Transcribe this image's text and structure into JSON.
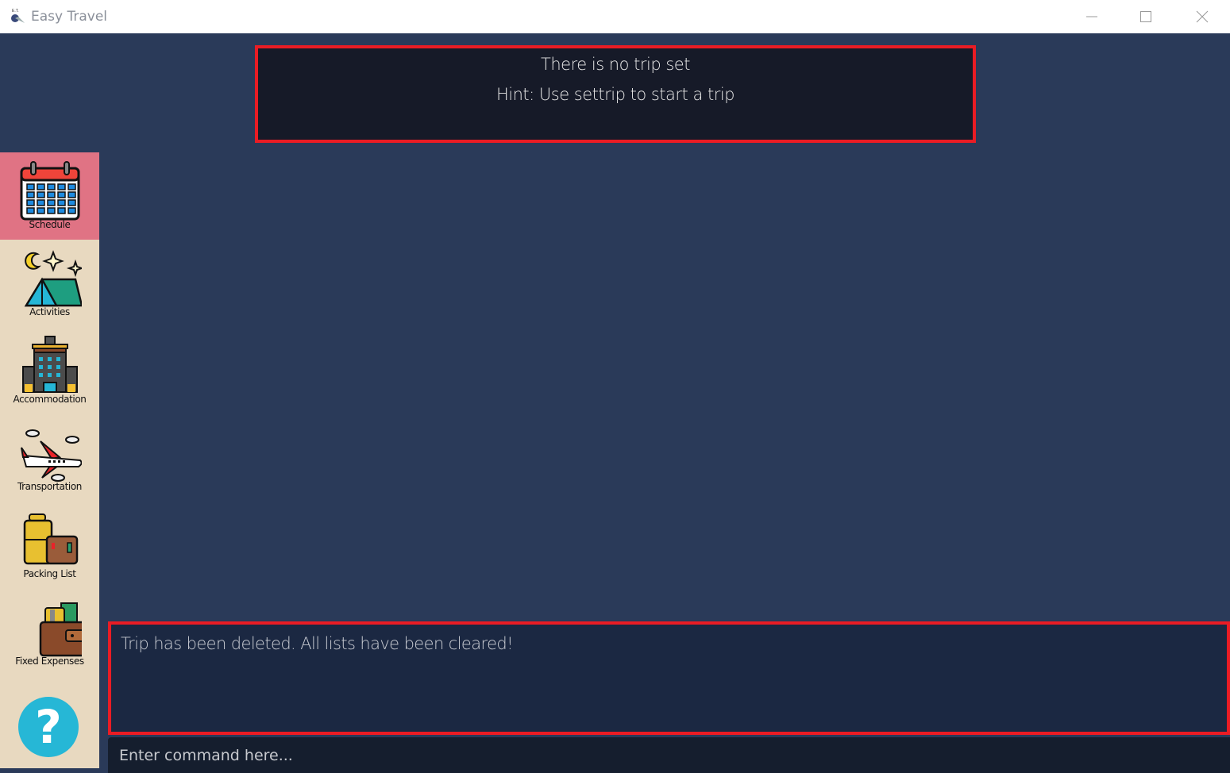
{
  "window": {
    "title": "Easy Travel",
    "app_icon": "easy-travel-logo-icon",
    "controls": [
      "minimize",
      "maximize",
      "close"
    ]
  },
  "trip_panel": {
    "message": "There is no trip set",
    "hint": "Hint: Use settrip to start a trip"
  },
  "sidebar": {
    "items": [
      {
        "label": "Schedule",
        "icon": "calendar-icon",
        "active": true
      },
      {
        "label": "Activities",
        "icon": "tent-night-icon",
        "active": false
      },
      {
        "label": "Accommodation",
        "icon": "hotel-icon",
        "active": false
      },
      {
        "label": "Transportation",
        "icon": "airplane-icon",
        "active": false
      },
      {
        "label": "Packing List",
        "icon": "luggage-icon",
        "active": false
      },
      {
        "label": "Fixed Expenses",
        "icon": "wallet-icon",
        "active": false
      }
    ],
    "help_label": "?"
  },
  "result_display": {
    "text": "Trip has been deleted. All lists have been cleared!"
  },
  "command_box": {
    "value": "",
    "placeholder": "Enter command here..."
  },
  "colors": {
    "background": "#2a3a59",
    "sidebar": "#e8d9c0",
    "active_item": "#e07384",
    "highlight_border": "#ea1c24",
    "help_button": "#26b7d6"
  }
}
